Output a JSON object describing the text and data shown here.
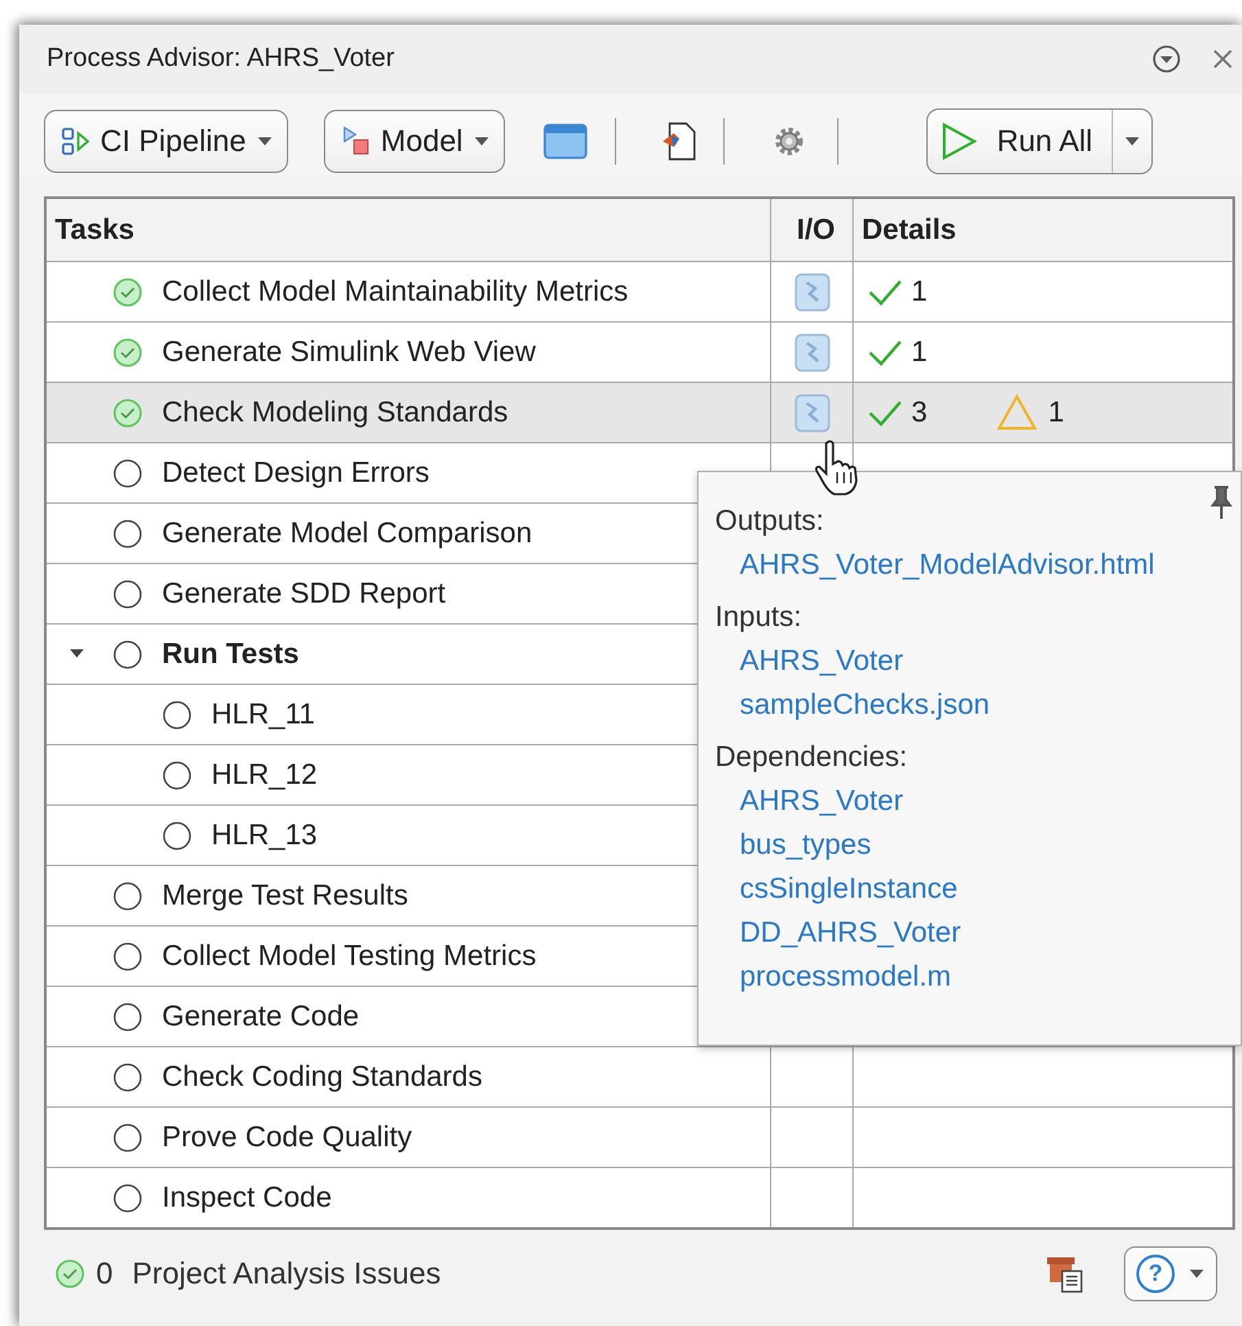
{
  "window": {
    "title": "Process Advisor: AHRS_Voter"
  },
  "toolbar": [
    {
      "kind": "pipeline",
      "label": "CI Pipeline"
    },
    {
      "kind": "model",
      "label": "Model"
    },
    {
      "kind": "panel"
    },
    {
      "kind": "separator"
    },
    {
      "kind": "import"
    },
    {
      "kind": "separator"
    },
    {
      "kind": "settings"
    },
    {
      "kind": "separator"
    },
    {
      "kind": "run",
      "label": "Run All"
    }
  ],
  "table": {
    "columns": [
      "Tasks",
      "I/O",
      "Details"
    ],
    "rows": [
      {
        "task": "Collect Model Maintainability Metrics",
        "completed": true,
        "has_io": true,
        "passed": "1",
        "selected": false
      },
      {
        "task": "Generate Simulink Web View",
        "completed": true,
        "has_io": true,
        "passed": "1",
        "selected": false
      },
      {
        "task": "Check Modeling Standards",
        "completed": true,
        "has_io": true,
        "passed": "3",
        "warnings": "1",
        "selected": true
      },
      {
        "task": "Detect Design Errors",
        "completed": false,
        "selected": false
      },
      {
        "task": "Generate Model Comparison",
        "completed": false,
        "selected": false
      },
      {
        "task": "Generate SDD Report",
        "completed": false,
        "selected": false
      },
      {
        "task": "Run Tests",
        "completed": false,
        "selected": false,
        "expanded": true,
        "children": [
          {
            "task": "HLR_11",
            "completed": false,
            "selected": false
          },
          {
            "task": "HLR_12",
            "completed": false,
            "selected": false
          },
          {
            "task": "HLR_13",
            "completed": false,
            "selected": false
          }
        ]
      },
      {
        "task": "Merge Test Results",
        "completed": false,
        "selected": false
      },
      {
        "task": "Collect Model Testing Metrics",
        "completed": false,
        "selected": false
      },
      {
        "task": "Generate Code",
        "completed": false,
        "selected": false
      },
      {
        "task": "Check Coding Standards",
        "completed": false,
        "selected": false
      },
      {
        "task": "Prove Code Quality",
        "completed": false,
        "selected": false
      },
      {
        "task": "Inspect Code",
        "completed": false,
        "selected": false
      }
    ]
  },
  "io_popup": {
    "sections": [
      {
        "heading": "Outputs:",
        "links": [
          "AHRS_Voter_ModelAdvisor.html"
        ]
      },
      {
        "heading": "Inputs:",
        "links": [
          "AHRS_Voter",
          "sampleChecks.json"
        ]
      },
      {
        "heading": "Dependencies:",
        "links": [
          "AHRS_Voter",
          "bus_types",
          "csSingleInstance",
          "DD_AHRS_Voter",
          "processmodel.m"
        ]
      }
    ]
  },
  "status_bar": {
    "count": "0",
    "label": "Project Analysis Issues",
    "help": "?"
  }
}
